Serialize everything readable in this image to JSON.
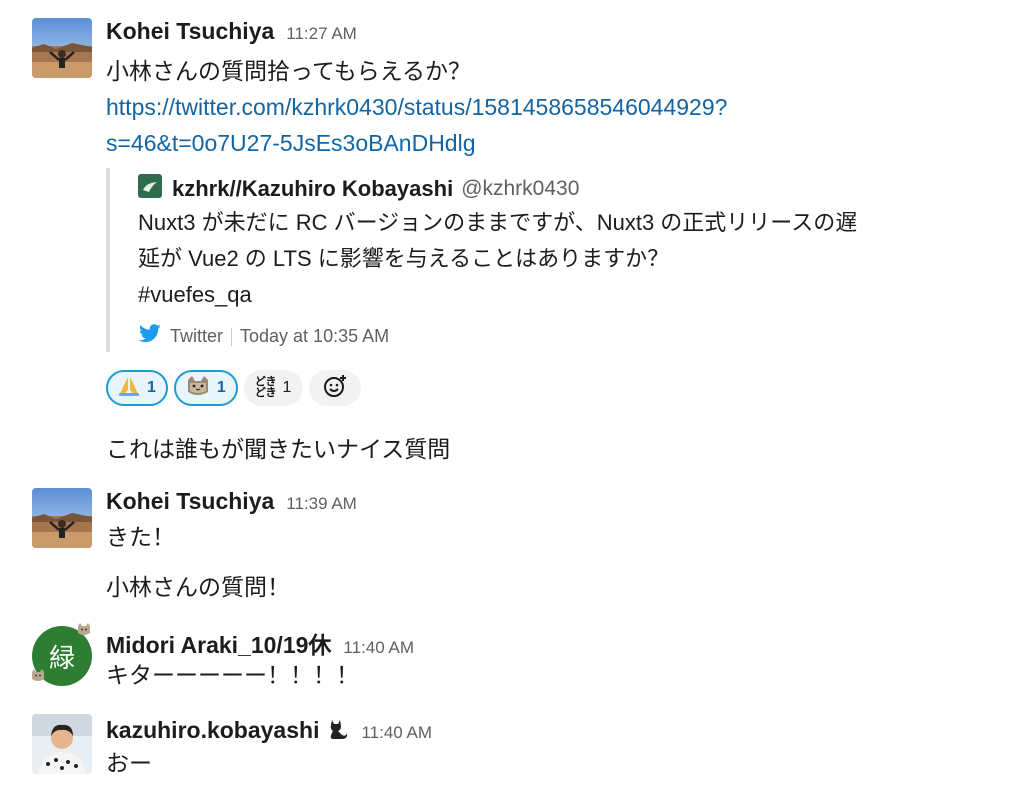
{
  "messages": [
    {
      "author": "Kohei Tsuchiya",
      "time": "11:27 AM",
      "text": "小林さんの質問拾ってもらえるか？",
      "link_line1": "https://twitter.com/kzhrk0430/status/1581458658546044929?",
      "link_line2": "s=46&t=0o7U27-5JsEs3oBAnDHdlg",
      "unfurl": {
        "author": "kzhrk//Kazuhiro Kobayashi",
        "handle": "@kzhrk0430",
        "text_line1": "Nuxt3 が未だに RC バージョンのままですが、Nuxt3 の正式リリースの遅",
        "text_line2": "延が Vue2 の LTS に影響を与えることはありますか？",
        "text_line3": "#vuefes_qa",
        "source": "Twitter",
        "timestamp": "Today at 10:35 AM"
      },
      "reactions": [
        {
          "emoji": "folded-hands",
          "count": "1",
          "active": true
        },
        {
          "emoji": "cat-face",
          "count": "1",
          "active": true
        },
        {
          "emoji": "dokidoki",
          "glyph": "どき\nどき",
          "count": "1",
          "active": false
        }
      ],
      "followup": "これは誰もが聞きたいナイス質問"
    },
    {
      "author": "Kohei Tsuchiya",
      "time": "11:39 AM",
      "text": "きた！",
      "followup": "小林さんの質問！"
    },
    {
      "author": "Midori Araki_10/19休",
      "time": "11:40 AM",
      "avatar_char": "緑",
      "avatar_color": "#2e7d32",
      "text": "キターーーーー！！！！"
    },
    {
      "author": "kazuhiro.kobayashi",
      "status_icon": "black-cat-icon",
      "time": "11:40 AM",
      "text": "おー"
    }
  ],
  "colors": {
    "link": "#1264a3",
    "twitter": "#1d9bf0",
    "reaction_active_border": "#1d9bd1"
  }
}
